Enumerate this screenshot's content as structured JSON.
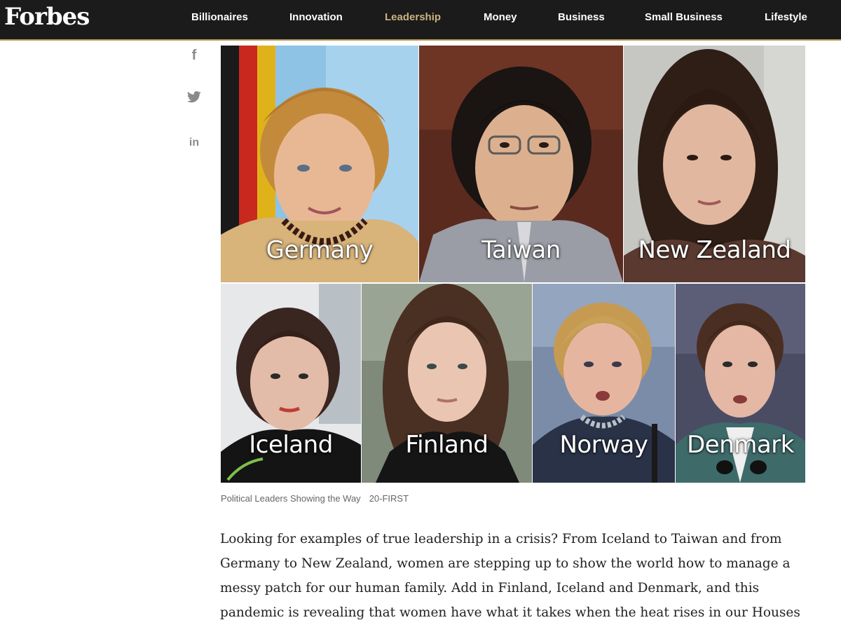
{
  "header": {
    "logo": "Forbes",
    "nav": [
      "Billionaires",
      "Innovation",
      "Leadership",
      "Money",
      "Business",
      "Small Business",
      "Lifestyle"
    ],
    "active_index": 2
  },
  "share": {
    "facebook": "f",
    "twitter_icon": "twitter-bird-icon",
    "linkedin": "in"
  },
  "collage": {
    "tiles": [
      {
        "country": "Germany"
      },
      {
        "country": "Taiwan"
      },
      {
        "country": "New Zealand"
      },
      {
        "country": "Iceland"
      },
      {
        "country": "Finland"
      },
      {
        "country": "Norway"
      },
      {
        "country": "Denmark"
      }
    ]
  },
  "caption": {
    "text": "Political Leaders Showing the Way",
    "credit": "20-FIRST"
  },
  "article": {
    "lines": [
      "Looking for examples of true leadership in a crisis? From Iceland to Taiwan and from",
      "Germany to New Zealand, women are stepping up to show the world how to manage a",
      "messy patch for our human family. Add in Finland, Iceland and Denmark, and this",
      "pandemic is revealing that women have what it takes when the heat rises in our Houses"
    ]
  },
  "colors": {
    "nav_bg": "#1b1b1b",
    "nav_active": "#c9b280",
    "accent_line": "#b89a5a",
    "body_text": "#222222",
    "caption_text": "#666666"
  }
}
